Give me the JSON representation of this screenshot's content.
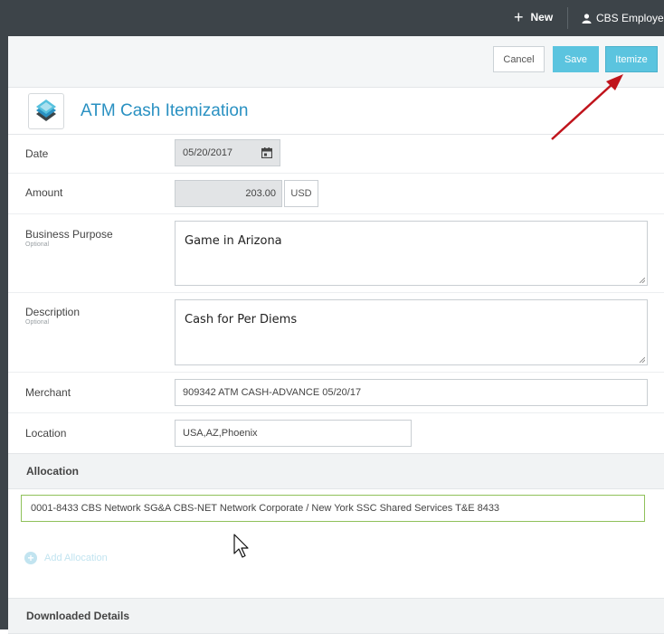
{
  "topbar": {
    "new_label": "New",
    "user_label": "CBS Employee"
  },
  "actions": {
    "cancel": "Cancel",
    "save": "Save",
    "itemize": "Itemize"
  },
  "page": {
    "title": "ATM Cash Itemization"
  },
  "form": {
    "date_label": "Date",
    "date_value": "05/20/2017",
    "amount_label": "Amount",
    "amount_value": "203.00",
    "currency": "USD",
    "purpose_label": "Business Purpose",
    "purpose_optional": "Optional",
    "purpose_value": "Game in Arizona",
    "description_label": "Description",
    "description_optional": "Optional",
    "description_value": "Cash for Per Diems",
    "merchant_label": "Merchant",
    "merchant_value": "909342 ATM CASH-ADVANCE 05/20/17",
    "location_label": "Location",
    "location_value": "USA,AZ,Phoenix"
  },
  "allocation": {
    "header": "Allocation",
    "value": "0001-8433 CBS Network SG&A CBS-NET Network Corporate / New York SSC Shared Services T&E 8433",
    "add_label": "Add Allocation"
  },
  "downloaded": {
    "header": "Downloaded Details"
  },
  "icons": {
    "plus": "plus-icon",
    "user": "user-icon",
    "calendar": "calendar-icon",
    "cash": "cash-stack-icon",
    "add": "add-circle-icon",
    "cursor": "mouse-pointer-icon",
    "arrow": "annotation-arrow-icon"
  },
  "colors": {
    "accent": "#5bc4df",
    "title": "#2a91c2",
    "topbar": "#3d4449",
    "annotation": "#c0141c",
    "allocation_border": "#8fc15a"
  }
}
